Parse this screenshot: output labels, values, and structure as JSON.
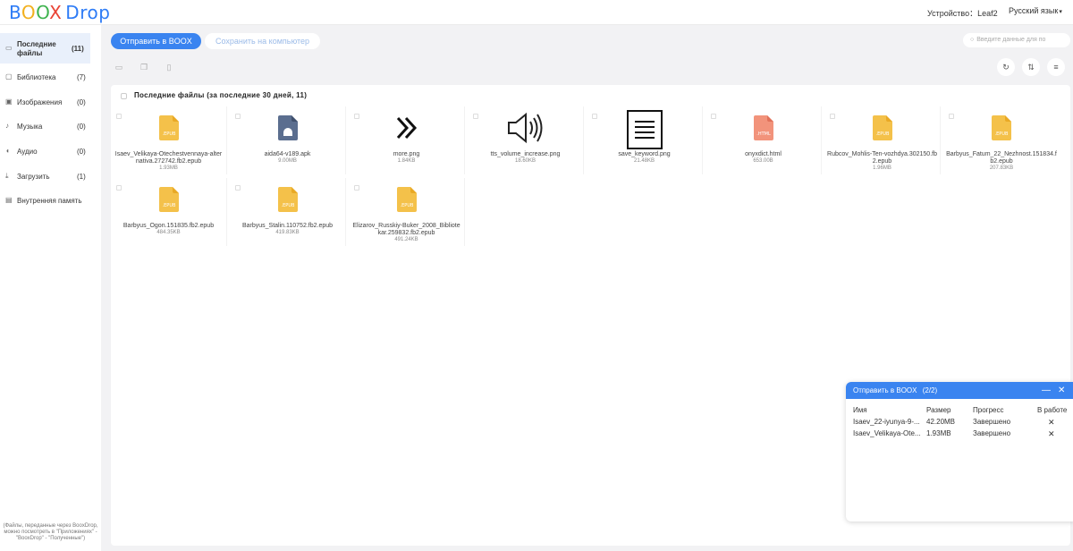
{
  "header": {
    "logo_boox": [
      "B",
      "O",
      "O",
      "X"
    ],
    "logo_drop": "Drop",
    "device_label": "Устройство：Leaf2",
    "language": "Русский язык"
  },
  "sidebar": {
    "items": [
      {
        "label": "Последние файлы",
        "count": "(11)",
        "icon": "clock-icon"
      },
      {
        "label": "Библиотека",
        "count": "(7)",
        "icon": "book-icon"
      },
      {
        "label": "Изображения",
        "count": "(0)",
        "icon": "image-icon"
      },
      {
        "label": "Музыка",
        "count": "(0)",
        "icon": "music-icon"
      },
      {
        "label": "Аудио",
        "count": "(0)",
        "icon": "audio-icon"
      },
      {
        "label": "Загрузить",
        "count": "(1)",
        "icon": "download-icon"
      },
      {
        "label": "Внутренняя память",
        "count": "",
        "icon": "storage-icon"
      }
    ],
    "note": "(Файлы, переданные через BooxDrop, можно посмотреть в \"Приложениях\" - \"BooxDrop\" - \"Полученные\")"
  },
  "toolbar": {
    "send_label": "Отправить в BOOX",
    "save_label": "Сохранить на компьютер",
    "search_placeholder": "Введите данные для по"
  },
  "panel": {
    "title": "Последние файлы (за последние 30 дней, 11)"
  },
  "files": [
    {
      "name": "Isaev_Velikaya-Otechestvennaya-alternativa.272742.fb2.epub",
      "size": "1.93MB",
      "type": "epub"
    },
    {
      "name": "aida64-v189.apk",
      "size": "9.00MB",
      "type": "apk"
    },
    {
      "name": "more.png",
      "size": "1.84KB",
      "type": "png-more"
    },
    {
      "name": "tts_volume_increase.png",
      "size": "18.60KB",
      "type": "png-volume"
    },
    {
      "name": "save_keyword.png",
      "size": "21.48KB",
      "type": "png-save"
    },
    {
      "name": "onyxdict.html",
      "size": "653.00B",
      "type": "html"
    },
    {
      "name": "Rubcov_Mohlis-Ten-vozhdya.302150.fb2.epub",
      "size": "1.96MB",
      "type": "epub"
    },
    {
      "name": "Barbyus_Fatum_22_Nezhnost.151834.fb2.epub",
      "size": "207.83KB",
      "type": "epub"
    },
    {
      "name": "Barbyus_Ogon.151835.fb2.epub",
      "size": "484.35KB",
      "type": "epub"
    },
    {
      "name": "Barbyus_Stalin.110752.fb2.epub",
      "size": "419.83KB",
      "type": "epub"
    },
    {
      "name": "Elizarov_Russkiy-Buker_2008_Bibliotekar.259832.fb2.epub",
      "size": "491.24KB",
      "type": "epub"
    }
  ],
  "transfer": {
    "title": "Отправить в BOOX",
    "count": "(2/2)",
    "columns": {
      "name": "Имя",
      "size": "Размер",
      "progress": "Прогресс",
      "status": "В работе"
    },
    "rows": [
      {
        "name": "Isaev_22-iyunya-9-...",
        "size": "42.20MB",
        "progress": "Завершено"
      },
      {
        "name": "Isaev_Velikaya-Ote...",
        "size": "1.93MB",
        "progress": "Завершено"
      }
    ]
  },
  "colors": {
    "accent": "#3a84f0",
    "epub_icon": "#f4c14a",
    "apk_icon": "#5b6e8f",
    "html_icon": "#f2937b"
  }
}
